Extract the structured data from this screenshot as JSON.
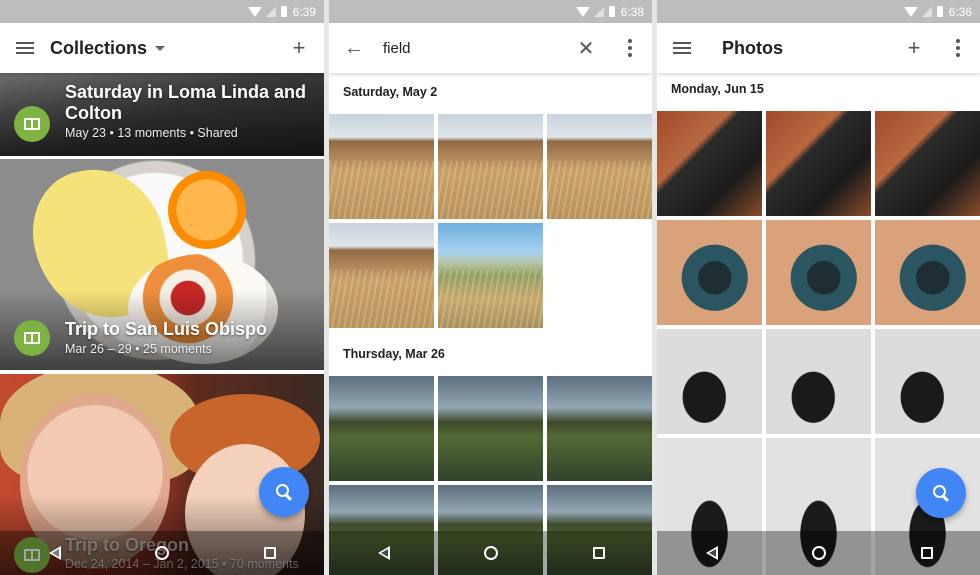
{
  "status_times": [
    "6:39",
    "6:38",
    "6:36"
  ],
  "collections": {
    "title": "Collections",
    "cards": [
      {
        "title": "Saturday in Loma Linda and Colton",
        "subtitle": "May 23  •  13 moments  •  Shared"
      },
      {
        "title": "Trip to San Luis Obispo",
        "subtitle": "Mar 26 – 29  •  25 moments"
      },
      {
        "title": "Trip to Oregon",
        "subtitle": "Dec 24, 2014 – Jan 2, 2015  •  70 moments"
      }
    ]
  },
  "search": {
    "query": "field",
    "sections": [
      "Saturday, May 2",
      "Thursday, Mar 26"
    ]
  },
  "photos": {
    "title": "Photos",
    "sections": [
      "Monday, Jun 15"
    ]
  },
  "icons": [
    "menu-icon",
    "caret-down-icon",
    "add-icon",
    "back-arrow-icon",
    "clear-icon",
    "more-vert-icon",
    "search-icon",
    "album-icon",
    "nav-back-icon",
    "nav-home-icon",
    "nav-recents-icon",
    "wifi-icon",
    "battery-icon"
  ],
  "colors": {
    "fab": "#4285f4",
    "album_badge": "#7cb342",
    "statusbar": "#bdbdbd"
  }
}
